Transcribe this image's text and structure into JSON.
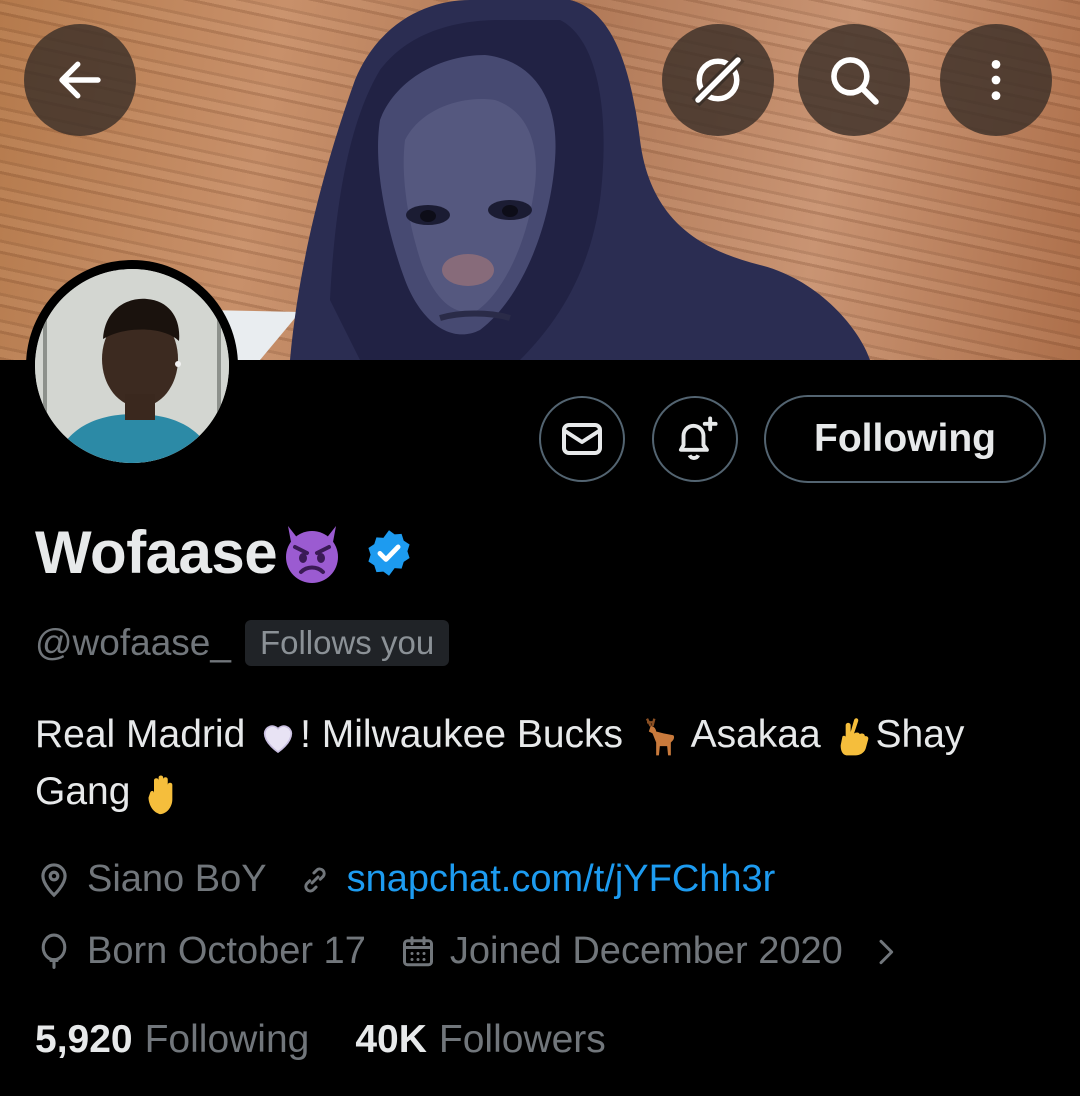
{
  "topbar": {
    "back_icon": "arrow-left-icon",
    "grok_icon": "grok-icon",
    "search_icon": "search-icon",
    "more_icon": "more-vertical-icon"
  },
  "actions": {
    "message_icon": "envelope-icon",
    "notify_icon": "bell-plus-icon",
    "follow_label": "Following"
  },
  "profile": {
    "display_name": "Wofaase",
    "name_emoji": "angry-devil-emoji",
    "verified_icon": "verified-badge-icon",
    "handle": "@wofaase_",
    "follows_you": "Follows you",
    "bio": {
      "part1": "Real Madrid ",
      "part2": "! Milwaukee Bucks ",
      "part3": " Asakaa ",
      "part4": "Shay Gang "
    },
    "location": "Siano BoY",
    "link": "snapchat.com/t/jYFChh3r",
    "birthday": "Born October 17",
    "joined": "Joined December 2020",
    "following_count": "5,920",
    "following_label": "Following",
    "followers_count": "40K",
    "followers_label": "Followers"
  },
  "colors": {
    "background": "#000000",
    "text": "#e7e9ea",
    "muted": "#71767b",
    "link": "#1d9bf0",
    "verified": "#1d9bf0",
    "border": "#536471"
  }
}
